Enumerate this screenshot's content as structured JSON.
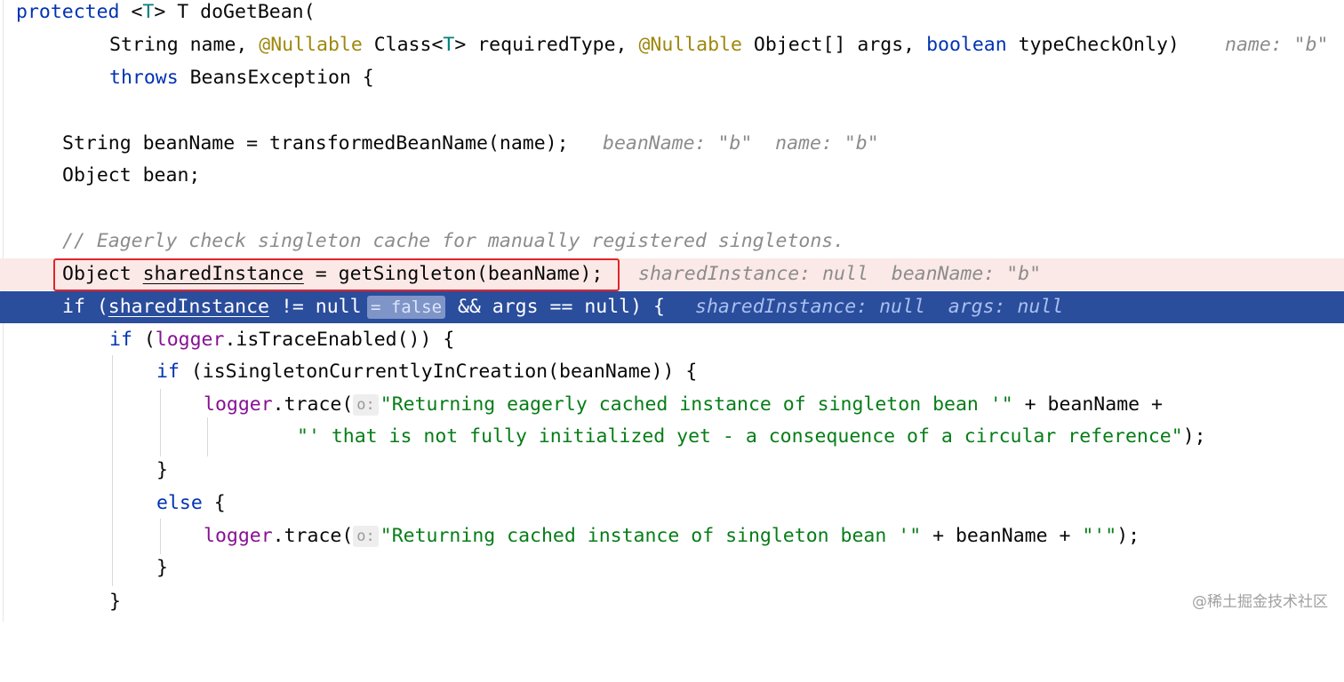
{
  "code": {
    "l1": {
      "kw": "protected",
      "lt": " <",
      "typ": "T",
      "rest": "> T doGetBean("
    },
    "l2": {
      "a": "String name, ",
      "ann1": "@Nullable",
      "b": " Class<",
      "typ": "T",
      "c": "> requiredType, ",
      "ann2": "@Nullable",
      "d": " Object[] args, ",
      "kw": "boolean",
      "e": " typeCheckOnly)",
      "hint": "name: \"b\""
    },
    "l3": {
      "kw": "throws",
      "rest": " BeansException {"
    },
    "l5": {
      "text": "String beanName = transformedBeanName(name);",
      "hint": "beanName: \"b\"  name: \"b\""
    },
    "l6": {
      "text": "Object bean;"
    },
    "l8": {
      "comment": "// Eagerly check singleton cache for manually registered singletons."
    },
    "l9": {
      "a": "Object ",
      "var": "sharedInstance",
      "b": " = getSingleton(beanName);",
      "hint": "sharedInstance: null  beanName: \"b\""
    },
    "l10": {
      "kw": "if",
      "a": " (",
      "var": "sharedInstance",
      "b": " != null",
      "badge": "= false",
      "c": " && args == null) {",
      "hint": "sharedInstance: null  args: null"
    },
    "l11": {
      "kw": "if",
      "a": " (",
      "fld": "logger",
      "b": ".isTraceEnabled()) {"
    },
    "l12": {
      "kw": "if",
      "rest": " (isSingletonCurrentlyInCreation(beanName)) {"
    },
    "l13": {
      "fld": "logger",
      "a": ".trace(",
      "inlay": "o:",
      "str": "\"Returning eagerly cached instance of singleton bean '\"",
      "b": " + beanName +"
    },
    "l14": {
      "str": "\"' that is not fully initialized yet - a consequence of a circular reference\"",
      "b": ");"
    },
    "l15": {
      "text": "}"
    },
    "l16": {
      "kw": "else",
      "rest": " {"
    },
    "l17": {
      "fld": "logger",
      "a": ".trace(",
      "inlay": "o:",
      "str1": "\"Returning cached instance of singleton bean '\"",
      "b": " + beanName + ",
      "str2": "\"'\"",
      "c": ");"
    },
    "l18": {
      "text": "}"
    },
    "l19": {
      "text": "}"
    }
  },
  "watermark": "@稀土掘金技术社区"
}
